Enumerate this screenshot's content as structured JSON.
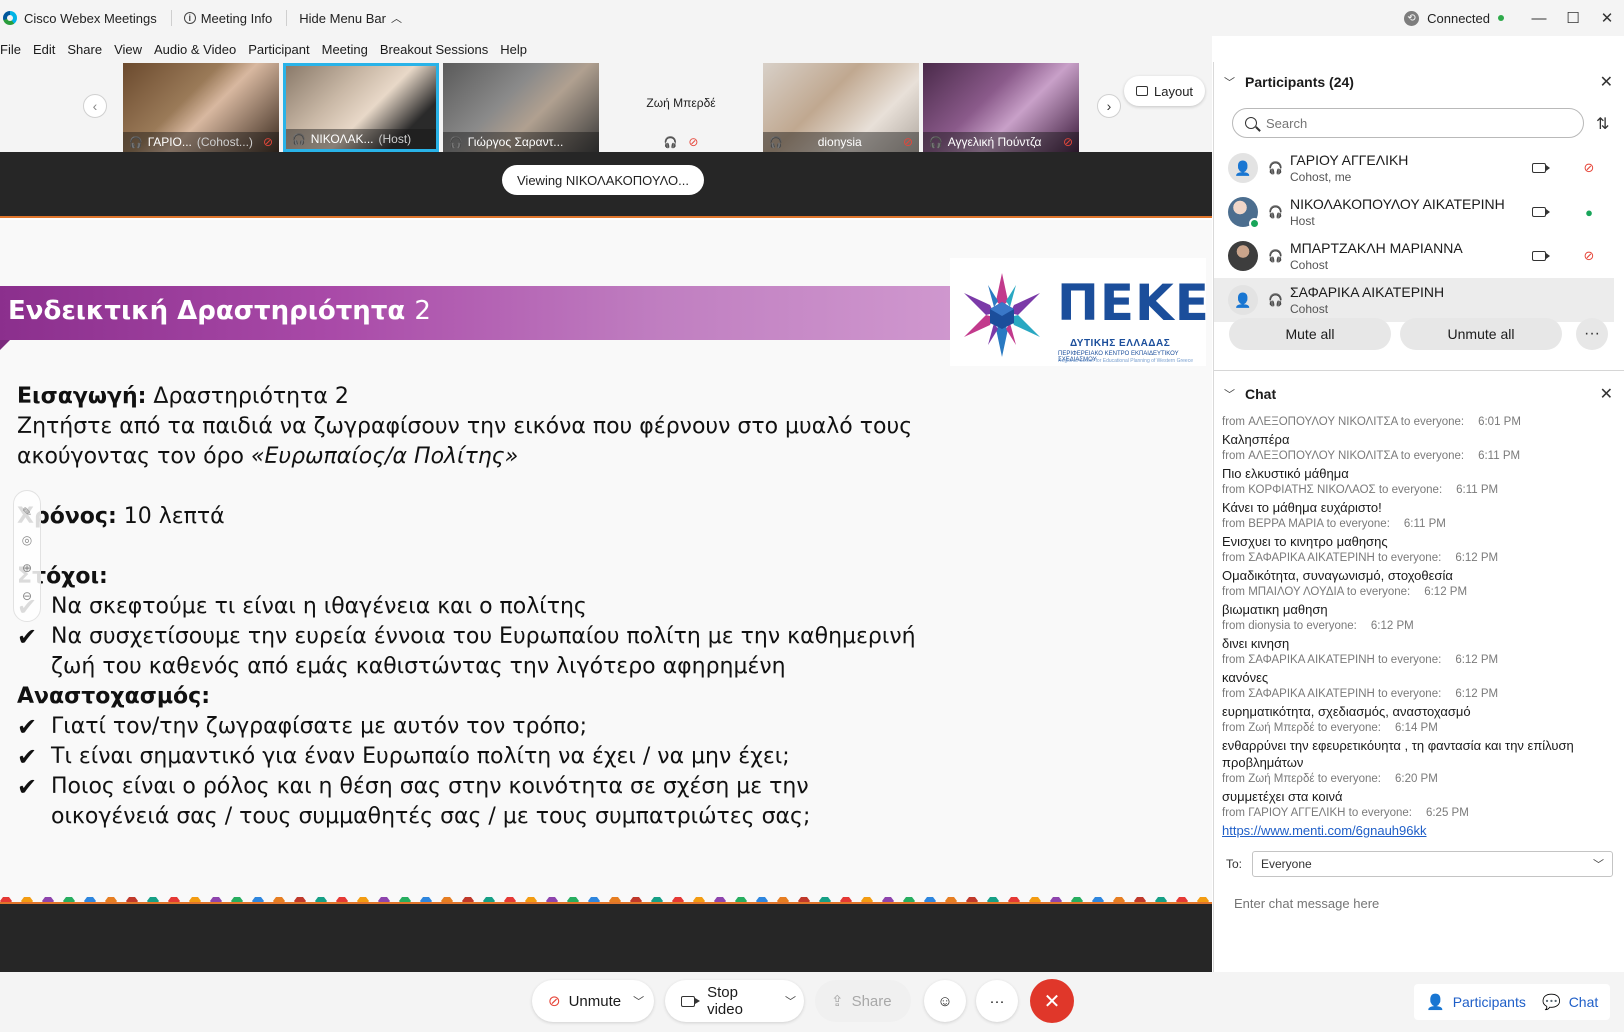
{
  "titlebar": {
    "app_name": "Cisco Webex Meetings",
    "meeting_info": "Meeting Info",
    "hide_menu": "Hide Menu Bar",
    "status": "Connected"
  },
  "menu": [
    "File",
    "Edit",
    "Share",
    "View",
    "Audio & Video",
    "Participant",
    "Meeting",
    "Breakout Sessions",
    "Help"
  ],
  "video_strip": {
    "tiles": [
      {
        "name": "ΓΑΡΙΟ...",
        "role": "(Cohost...)"
      },
      {
        "name": "ΝΙΚΟΛΑΚ...",
        "role": "(Host)"
      },
      {
        "name": "Γιώργος Σαραντ...",
        "role": ""
      },
      {
        "name": "Ζωή Μπερδέ",
        "role": ""
      },
      {
        "name": "dionysia",
        "role": ""
      },
      {
        "name": "Αγγελική Πούντζα",
        "role": ""
      }
    ],
    "layout_label": "Layout"
  },
  "stage": {
    "viewing": "Viewing ΝΙΚΟΛΑΚΟΠΟΥΛΟ..."
  },
  "slide": {
    "title": "Ενδεικτική Δραστηριότητα",
    "title_num": "2",
    "logo_main": "ΠΕΚΕΣ",
    "logo_sub": "ΔΥΤΙΚΗΣ ΕΛΛΑΔΑΣ",
    "logo_sub2": "ΠΕΡΙΦΕΡΕΙΑΚΟ ΚΕΝΤΡΟ ΕΚΠΑΙΔΕΥΤΙΚΟΥ ΣΧΕΔΙΑΣΜΟΥ",
    "logo_sub3": "Regional Center for Educational Planning of Western Greece",
    "intro_label": "Εισαγωγή:",
    "intro_text": " Δραστηριότητα 2",
    "line1": "Ζητήστε από  τα παιδιά να ζωγραφίσουν την εικόνα που φέρνουν στο μυαλό τους",
    "line2a": "ακούγοντας τον όρο ",
    "line2b": "«Ευρωπαίος/α Πολίτης»",
    "time_label": "Χρόνος:",
    "time_text": " 10 λεπτά",
    "goals_label": "Στόχοι:",
    "goals": [
      "Να σκεφτούμε τι είναι η ιθαγένεια και ο πολίτης",
      "Να συσχετίσουμε την ευρεία έννοια του Ευρωπαίου πολίτη με την καθημερινή ζωή του καθενός από εμάς καθιστώντας την λιγότερο αφηρημένη"
    ],
    "reflection_label": "Αναστοχασμός:",
    "reflection": [
      "Γιατί τον/την ζωγραφίσατε με αυτόν τον τρόπο;",
      "Τι είναι σημαντικό για έναν Ευρωπαίο πολίτη να έχει / να μην έχει;",
      "Ποιος είναι ο ρόλος και η θέση σας στην κοινότητα σε σχέση με την οικογένειά σας / τους συμμαθητές σας / με τους συμπατριώτες σας;"
    ],
    "check_glyph": "✔"
  },
  "participants": {
    "title": "Participants (24)",
    "search_placeholder": "Search",
    "list": [
      {
        "name": "ΓΑΡΙΟΥ ΑΓΓΕΛΙΚΗ",
        "role": "Cohost, me",
        "mic": "muted"
      },
      {
        "name": "ΝΙΚΟΛΑΚΟΠΟΥΛΟΥ ΑΙΚΑΤΕΡΙΝΗ",
        "role": "Host",
        "mic": "on"
      },
      {
        "name": "ΜΠΑΡΤΖΑΚΛΗ ΜΑΡΙΑΝΝΑ",
        "role": "Cohost",
        "mic": "muted"
      },
      {
        "name": "ΣΑΦΑΡΙΚΑ ΑΙΚΑΤΕΡΙΝΗ",
        "role": "Cohost",
        "mic": ""
      }
    ],
    "mute_all": "Mute all",
    "unmute_all": "Unmute all"
  },
  "chat": {
    "title": "Chat",
    "messages": [
      {
        "from": "from ΑΛΕΞΟΠΟΥΛΟΥ ΝΙΚΟΛΙΤΣΑ to everyone:",
        "time": "6:01 PM",
        "text": "Καλησπέρα"
      },
      {
        "from": "from ΑΛΕΞΟΠΟΥΛΟΥ ΝΙΚΟΛΙΤΣΑ to everyone:",
        "time": "6:11 PM",
        "text": "Πιο ελκυστικό μάθημα"
      },
      {
        "from": "from ΚΟΡΦΙΑΤΗΣ ΝΙΚΟΛΑΟΣ to everyone:",
        "time": "6:11 PM",
        "text": "Κάνει το μάθημα ευχάριστο!"
      },
      {
        "from": "from ΒΕΡΡΑ ΜΑΡΙΑ to everyone:",
        "time": "6:11 PM",
        "text": "Ενισχυει το κινητρο μαθησης"
      },
      {
        "from": "from ΣΑΦΑΡΙΚΑ ΑΙΚΑΤΕΡΙΝΗ to everyone:",
        "time": "6:12 PM",
        "text": "Ομαδικότητα, συναγωνισμό, στοχοθεσία"
      },
      {
        "from": "from ΜΠΑΙΛΟΥ ΛΟΥΔΙΑ to everyone:",
        "time": "6:12 PM",
        "text": "βιωματικη μαθηση"
      },
      {
        "from": "from dionysia to everyone:",
        "time": "6:12 PM",
        "text": "δινει  κινηση"
      },
      {
        "from": "from ΣΑΦΑΡΙΚΑ ΑΙΚΑΤΕΡΙΝΗ to everyone:",
        "time": "6:12 PM",
        "text": "κανόνες"
      },
      {
        "from": "from ΣΑΦΑΡΙΚΑ ΑΙΚΑΤΕΡΙΝΗ to everyone:",
        "time": "6:12 PM",
        "text": "ευρηματικότητα, σχεδιασμός, αναστοχασμό"
      },
      {
        "from": "from Ζωή Μπερδέ to everyone:",
        "time": "6:14 PM",
        "text": "ενθαρρύνει την εφευρετικόυητα , τη φαντασία και την επίλυση προβλημάτων"
      },
      {
        "from": "from Ζωή Μπερδέ to everyone:",
        "time": "6:20 PM",
        "text": "συμμετέχει στα κοινά"
      },
      {
        "from": "from ΓΑΡΙΟΥ ΑΓΓΕΛΙΚΗ to everyone:",
        "time": "6:25 PM",
        "link": "https://www.menti.com/6gnauh96kk"
      }
    ],
    "to_label": "To:",
    "to_value": "Everyone",
    "input_placeholder": "Enter chat message here"
  },
  "controls": {
    "unmute": "Unmute",
    "stop_video": "Stop video",
    "share": "Share",
    "participants_tab": "Participants",
    "chat_tab": "Chat"
  },
  "colors": {
    "accent_blue": "#29b3e8",
    "end_red": "#e0372a",
    "banner_purple": "#a94aa8",
    "orange_rule": "#e0752b"
  }
}
